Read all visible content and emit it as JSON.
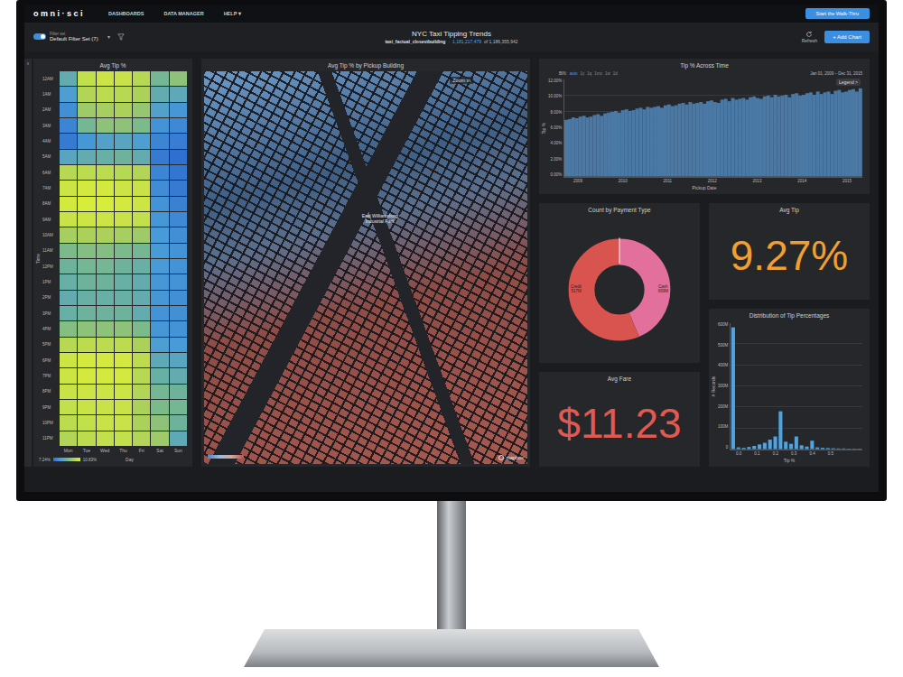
{
  "app": {
    "logo": "omni·sci",
    "nav": [
      {
        "label": "DASHBOARDS"
      },
      {
        "label": "DATA MANAGER"
      },
      {
        "label": "HELP ▾"
      }
    ],
    "cta": "Start the Walk-Thru"
  },
  "filter": {
    "label": "Filter set",
    "value": "Default Filter Set (7)",
    "on": true,
    "caret": "▾"
  },
  "dashboard": {
    "title": "NYC Taxi Tipping Trends",
    "table": "taxi_factual_closestbuilding",
    "separator": "·",
    "filtered": "1,181,217,479",
    "total": "of 1,186,355,942",
    "refresh": "Refresh",
    "add_chart": "+ Add Chart"
  },
  "sidebar_toggle": "›",
  "heatmap": {
    "title": "Avg Tip %",
    "y_axis": "Time",
    "x_axis": "Day",
    "legend_min": "7.24%",
    "legend_max": "10.83%",
    "columns": [
      "Mon",
      "Tue",
      "Wed",
      "Thu",
      "Fri",
      "Sat",
      "Sun"
    ],
    "rows": [
      {
        "label": "12AM",
        "values": [
          9.0,
          10.4,
          10.6,
          10.5,
          10.2,
          9.3,
          9.6
        ]
      },
      {
        "label": "1AM",
        "values": [
          8.6,
          10.1,
          10.3,
          10.2,
          10.0,
          9.0,
          8.9
        ]
      },
      {
        "label": "2AM",
        "values": [
          8.2,
          9.8,
          9.9,
          10.0,
          9.7,
          8.7,
          8.4
        ]
      },
      {
        "label": "3AM",
        "values": [
          7.9,
          9.3,
          9.6,
          9.6,
          9.4,
          8.3,
          8.0
        ]
      },
      {
        "label": "4AM",
        "values": [
          7.6,
          8.4,
          8.7,
          8.8,
          8.6,
          7.9,
          7.7
        ]
      },
      {
        "label": "5AM",
        "values": [
          8.8,
          9.0,
          9.1,
          9.2,
          9.0,
          7.6,
          7.3
        ]
      },
      {
        "label": "6AM",
        "values": [
          10.2,
          10.3,
          10.3,
          10.2,
          10.1,
          7.9,
          7.5
        ]
      },
      {
        "label": "7AM",
        "values": [
          10.6,
          10.7,
          10.7,
          10.6,
          10.5,
          8.1,
          7.6
        ]
      },
      {
        "label": "8AM",
        "values": [
          10.7,
          10.8,
          10.8,
          10.7,
          10.6,
          8.3,
          7.8
        ]
      },
      {
        "label": "9AM",
        "values": [
          10.5,
          10.6,
          10.6,
          10.5,
          10.4,
          8.4,
          8.0
        ]
      },
      {
        "label": "10AM",
        "values": [
          9.9,
          10.0,
          10.0,
          9.9,
          9.8,
          8.5,
          8.2
        ]
      },
      {
        "label": "11AM",
        "values": [
          9.4,
          9.5,
          9.5,
          9.4,
          9.3,
          8.5,
          8.3
        ]
      },
      {
        "label": "12PM",
        "values": [
          9.2,
          9.3,
          9.3,
          9.2,
          9.1,
          8.5,
          8.3
        ]
      },
      {
        "label": "1PM",
        "values": [
          9.1,
          9.2,
          9.2,
          9.1,
          9.0,
          8.4,
          8.3
        ]
      },
      {
        "label": "2PM",
        "values": [
          9.0,
          9.1,
          9.1,
          9.1,
          9.0,
          8.4,
          8.2
        ]
      },
      {
        "label": "3PM",
        "values": [
          9.1,
          9.2,
          9.2,
          9.2,
          9.0,
          8.3,
          8.2
        ]
      },
      {
        "label": "4PM",
        "values": [
          9.5,
          9.6,
          9.6,
          9.6,
          9.4,
          8.4,
          8.3
        ]
      },
      {
        "label": "5PM",
        "values": [
          10.2,
          10.3,
          10.3,
          10.3,
          10.0,
          8.6,
          8.5
        ]
      },
      {
        "label": "6PM",
        "values": [
          10.6,
          10.7,
          10.7,
          10.7,
          10.3,
          8.9,
          8.8
        ]
      },
      {
        "label": "7PM",
        "values": [
          10.6,
          10.7,
          10.7,
          10.7,
          10.2,
          9.1,
          9.0
        ]
      },
      {
        "label": "8PM",
        "values": [
          10.5,
          10.6,
          10.6,
          10.6,
          10.1,
          9.3,
          9.2
        ]
      },
      {
        "label": "9PM",
        "values": [
          10.4,
          10.5,
          10.5,
          10.5,
          10.0,
          9.4,
          9.3
        ]
      },
      {
        "label": "10PM",
        "values": [
          10.3,
          10.4,
          10.5,
          10.5,
          10.0,
          9.6,
          9.2
        ]
      },
      {
        "label": "11PM",
        "values": [
          10.1,
          10.3,
          10.4,
          10.4,
          10.1,
          9.8,
          8.9
        ]
      }
    ]
  },
  "map": {
    "title": "Avg Tip % by Pickup Building",
    "zoom_hint": "Zoom in",
    "area_label": "East Williamsburg Industrial Park",
    "attribution": "mapbox"
  },
  "line_chart": {
    "title": "Tip % Across Time",
    "bin_label": "BIN:",
    "bins": [
      {
        "label": "auto",
        "selected": true
      },
      {
        "label": "1y",
        "selected": false
      },
      {
        "label": "1q",
        "selected": false
      },
      {
        "label": "1mo",
        "selected": false
      },
      {
        "label": "1w",
        "selected": false
      },
      {
        "label": "1d",
        "selected": false
      }
    ],
    "date_range": "Jan 01, 2009 – Dec 31, 2015",
    "legend": "Legend >",
    "y_axis": "Tip %",
    "x_axis": "Pickup Date",
    "y_ticks": [
      "12.00%",
      "10.00%",
      "8.00%",
      "6.00%",
      "4.00%",
      "2.00%",
      "0.00%"
    ],
    "x_ticks": [
      "2009",
      "2010",
      "2011",
      "2012",
      "2013",
      "2014",
      "2015"
    ],
    "values": [
      7.0,
      7.1,
      7.3,
      7.2,
      7.4,
      7.5,
      7.3,
      7.4,
      7.6,
      7.7,
      7.5,
      7.8,
      7.9,
      8.0,
      8.1,
      7.9,
      8.2,
      8.3,
      8.1,
      8.2,
      8.4,
      8.5,
      8.3,
      8.6,
      8.5,
      8.6,
      8.7,
      8.5,
      8.8,
      8.9,
      8.7,
      8.8,
      9.0,
      9.1,
      8.9,
      9.2,
      9.0,
      9.1,
      9.2,
      9.0,
      9.3,
      9.4,
      9.2,
      9.1,
      9.5,
      9.6,
      9.3,
      9.7,
      9.5,
      9.6,
      9.7,
      9.5,
      9.8,
      9.9,
      9.7,
      9.6,
      9.9,
      10.0,
      9.8,
      10.1,
      9.9,
      10.0,
      10.1,
      9.8,
      10.2,
      10.3,
      10.0,
      10.1,
      10.3,
      10.4,
      10.1,
      10.5,
      10.2,
      10.4,
      10.5,
      10.2,
      10.6,
      10.7,
      10.4,
      10.5,
      10.7,
      10.8,
      10.5,
      10.9
    ]
  },
  "payment_chart": {
    "title": "Count by Payment Type",
    "segments": [
      {
        "label": "Credit",
        "value_text": "517M",
        "value": 517,
        "color": "#e36f9c"
      },
      {
        "label": "Cash",
        "value_text": "669M",
        "value": 669,
        "color": "#d9534f"
      }
    ]
  },
  "avg_tip": {
    "title": "Avg Tip",
    "value": "9.27%"
  },
  "avg_fare": {
    "title": "Avg Fare",
    "value": "$11.23"
  },
  "histogram": {
    "title": "Distribution of Tip Percentages",
    "y_axis": "# Records",
    "x_axis": "Tip %",
    "y_ticks": [
      "600M",
      "500M",
      "400M",
      "300M",
      "200M",
      "100M",
      "0"
    ],
    "x_ticks": [
      "0.0",
      "0.1",
      "0.2",
      "0.3",
      "0.4",
      "0.5"
    ],
    "values": [
      580,
      8,
      6,
      10,
      15,
      22,
      30,
      45,
      60,
      180,
      35,
      25,
      60,
      18,
      12,
      40,
      8,
      6,
      5,
      4,
      3,
      3,
      2,
      2,
      2
    ]
  }
}
